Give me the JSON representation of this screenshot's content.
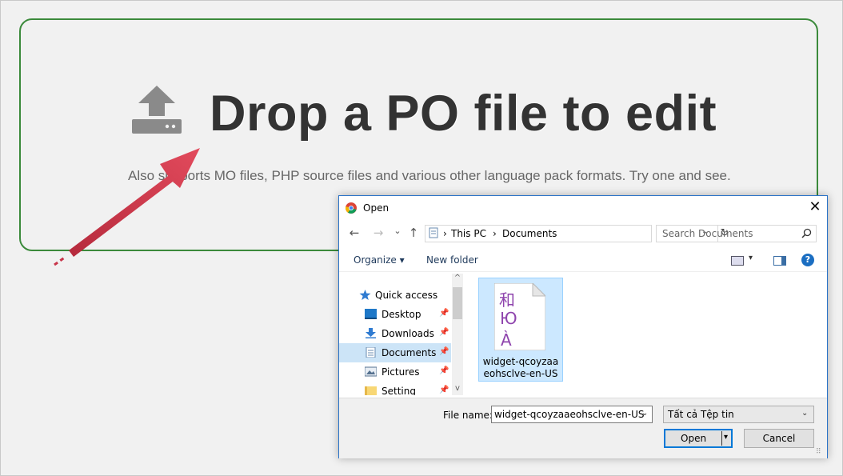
{
  "dropzone": {
    "title": "Drop a PO file to edit",
    "subtitle": "Also supports MO files, PHP source files and various other language pack formats. Try one and see."
  },
  "dialog": {
    "title": "Open",
    "close_glyph": "✕",
    "nav": {
      "back": "←",
      "forward": "→",
      "recent": "⌄",
      "up": "↑"
    },
    "address": {
      "seg1": "This PC",
      "seg2": "Documents",
      "sep": "›",
      "refresh": "↻",
      "dropdown": "⌄"
    },
    "search": {
      "placeholder": "Search Documents"
    },
    "toolbar": {
      "organize": "Organize ▾",
      "new_folder": "New folder",
      "view_caret": "▾",
      "help": "?"
    },
    "sidebar": {
      "items": [
        {
          "label": "Quick access"
        },
        {
          "label": "Desktop",
          "pin": "📌"
        },
        {
          "label": "Downloads",
          "pin": "📌"
        },
        {
          "label": "Documents",
          "pin": "📌"
        },
        {
          "label": "Pictures",
          "pin": "📌"
        },
        {
          "label": "Setting",
          "pin": "📌"
        }
      ],
      "scroll_up": "^",
      "scroll_down": "v"
    },
    "file": {
      "name": "widget-qcoyzaaeohsclve-en-US",
      "glyph1": "和",
      "glyph2": "Ю",
      "glyph3": "À"
    },
    "bottom": {
      "file_name_label": "File name:",
      "file_name_value": "widget-qcoyzaaeohsclve-en-US",
      "file_type": "Tất cả Tệp tin",
      "open": "Open",
      "cancel": "Cancel",
      "caret": "⌄",
      "open_caret": "▾",
      "grip": "⠿"
    }
  },
  "colors": {
    "accent": "#3b8a3b",
    "arrow": "#d9344a",
    "selection": "#cce8ff"
  },
  "icons": [
    "upload-icon",
    "arrow-annotation",
    "chrome-icon",
    "search-icon",
    "star-icon",
    "desktop-icon",
    "downloads-icon",
    "documents-icon",
    "pictures-icon",
    "folder-icon",
    "help-icon",
    "file-icon"
  ]
}
